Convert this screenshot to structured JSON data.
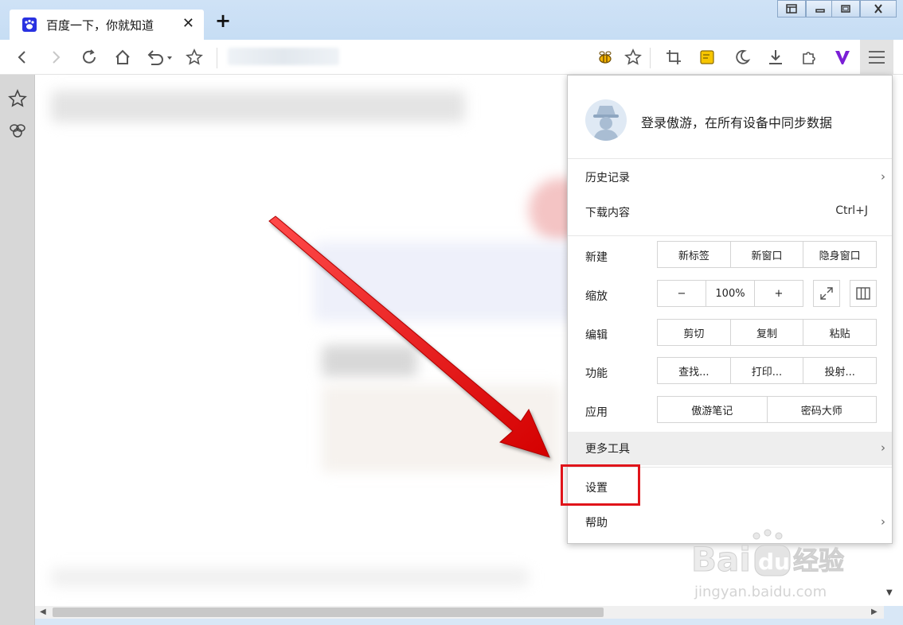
{
  "tab": {
    "title": "百度一下，你就知道",
    "close_glyph": "✕"
  },
  "new_tab_glyph": "+",
  "menu": {
    "login_text": "登录傲游，在所有设备中同步数据",
    "history": {
      "label": "历史记录",
      "chevron": "›"
    },
    "downloads": {
      "label": "下载内容",
      "shortcut": "Ctrl+J"
    },
    "new": {
      "label": "新建",
      "buttons": [
        "新标签",
        "新窗口",
        "隐身窗口"
      ]
    },
    "zoom": {
      "label": "缩放",
      "minus": "−",
      "value": "100%",
      "plus": "+"
    },
    "edit": {
      "label": "编辑",
      "buttons": [
        "剪切",
        "复制",
        "粘贴"
      ]
    },
    "features": {
      "label": "功能",
      "buttons": [
        "查找...",
        "打印...",
        "投射..."
      ]
    },
    "apps": {
      "label": "应用",
      "buttons": [
        "傲游笔记",
        "密码大师"
      ]
    },
    "more_tools": {
      "label": "更多工具",
      "chevron": "›"
    },
    "settings": {
      "label": "设置"
    },
    "help": {
      "label": "帮助",
      "chevron": "›"
    }
  },
  "watermark": {
    "brand": "Bai",
    "brand2": "du",
    "cn": "经验",
    "url": "jingyan.baidu.com"
  },
  "colors": {
    "highlight": "#e0141a",
    "titlebar": "#c6ddf4",
    "menu_hover": "#eeeeee"
  },
  "icons": [
    "back-icon",
    "forward-icon",
    "reload-icon",
    "home-icon",
    "undo-icon",
    "star-icon",
    "bee-icon",
    "crop-icon",
    "note-icon",
    "moon-icon",
    "download-icon",
    "puzzle-icon",
    "maxthon-icon",
    "hamburger-icon"
  ]
}
